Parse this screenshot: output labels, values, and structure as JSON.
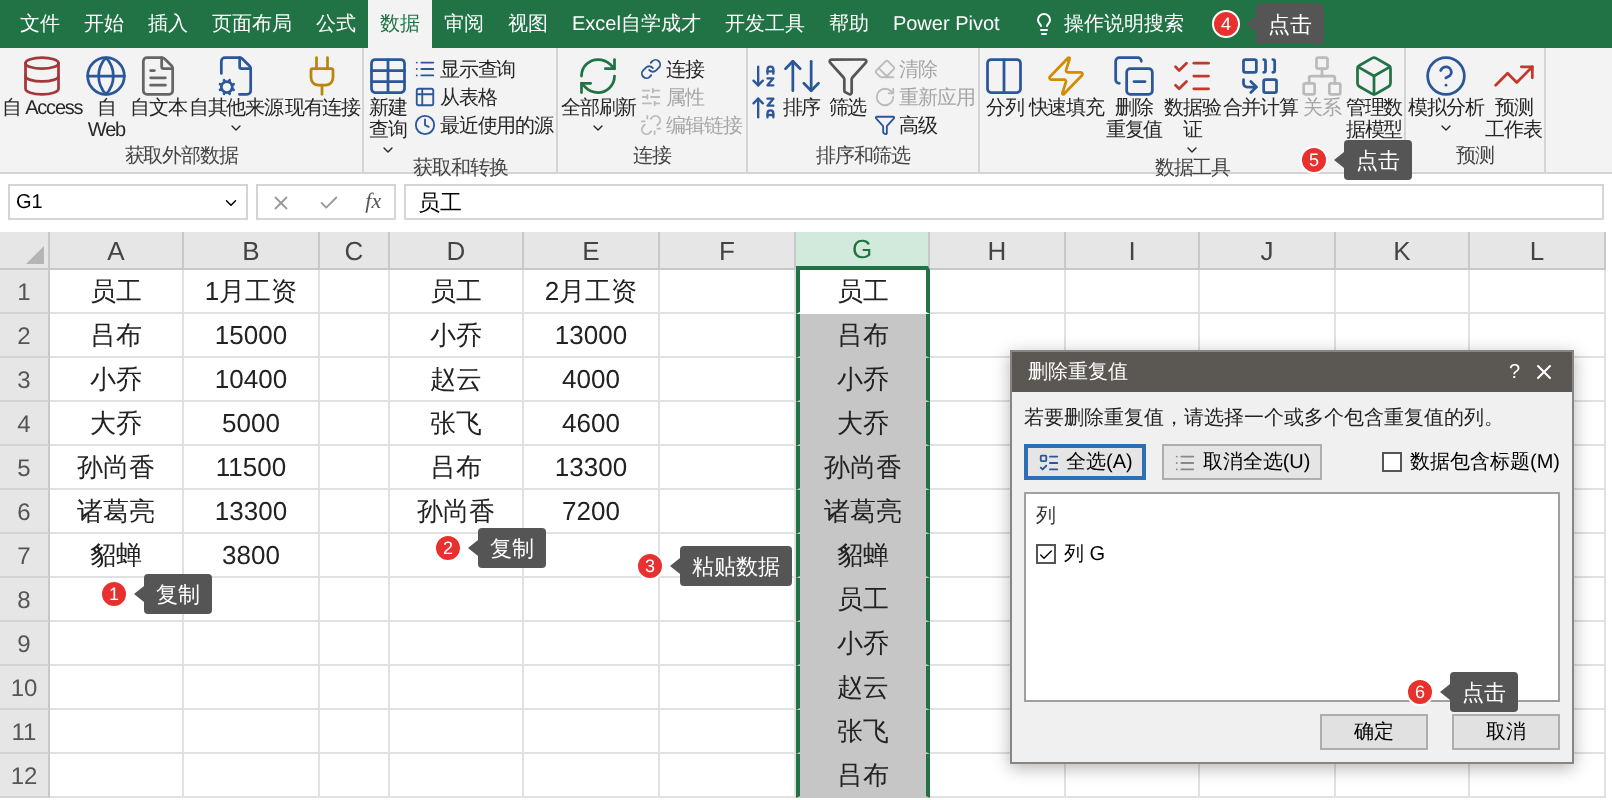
{
  "tabs": [
    {
      "label": "文件",
      "selected": false
    },
    {
      "label": "开始",
      "selected": false
    },
    {
      "label": "插入",
      "selected": false
    },
    {
      "label": "页面布局",
      "selected": false
    },
    {
      "label": "公式",
      "selected": false
    },
    {
      "label": "数据",
      "selected": true
    },
    {
      "label": "审阅",
      "selected": false
    },
    {
      "label": "视图",
      "selected": false
    },
    {
      "label": "Excel自学成才",
      "selected": false
    },
    {
      "label": "开发工具",
      "selected": false
    },
    {
      "label": "帮助",
      "selected": false
    },
    {
      "label": "Power Pivot",
      "selected": false
    }
  ],
  "search": {
    "label": "操作说明搜索"
  },
  "ribbon": {
    "groups": [
      {
        "label": "获取外部数据",
        "items": [
          {
            "kind": "large",
            "lines": [
              "自 Access"
            ],
            "dropdown": false,
            "disabled": false
          },
          {
            "kind": "large",
            "lines": [
              "自",
              "Web"
            ],
            "dropdown": false,
            "disabled": false
          },
          {
            "kind": "large",
            "lines": [
              "自文本"
            ],
            "dropdown": false,
            "disabled": false
          },
          {
            "kind": "large",
            "lines": [
              "自其他来源"
            ],
            "dropdown": true,
            "disabled": false
          },
          {
            "kind": "large",
            "lines": [
              "现有连接"
            ],
            "dropdown": false,
            "disabled": false
          }
        ]
      },
      {
        "label": "获取和转换",
        "items": [
          {
            "kind": "large",
            "lines": [
              "新建",
              "查询"
            ],
            "dropdown": true,
            "disabled": false
          },
          {
            "kind": "stack",
            "entries": [
              {
                "label": "显示查询",
                "disabled": false
              },
              {
                "label": "从表格",
                "disabled": false
              },
              {
                "label": "最近使用的源",
                "disabled": false
              }
            ]
          }
        ]
      },
      {
        "label": "连接",
        "items": [
          {
            "kind": "large",
            "lines": [
              "全部刷新"
            ],
            "dropdown": true,
            "disabled": false
          },
          {
            "kind": "stack",
            "entries": [
              {
                "label": "连接",
                "disabled": false
              },
              {
                "label": "属性",
                "disabled": true
              },
              {
                "label": "编辑链接",
                "disabled": true
              }
            ]
          }
        ]
      },
      {
        "label": "排序和筛选",
        "items": [
          {
            "kind": "sort_pair"
          },
          {
            "kind": "large",
            "lines": [
              "排序"
            ],
            "dropdown": false,
            "disabled": false
          },
          {
            "kind": "large",
            "lines": [
              "筛选"
            ],
            "dropdown": false,
            "disabled": false
          },
          {
            "kind": "stack",
            "entries": [
              {
                "label": "清除",
                "disabled": true
              },
              {
                "label": "重新应用",
                "disabled": true
              },
              {
                "label": "高级",
                "disabled": false
              }
            ]
          }
        ]
      },
      {
        "label": "数据工具",
        "items": [
          {
            "kind": "large",
            "lines": [
              "分列"
            ],
            "dropdown": false,
            "disabled": false
          },
          {
            "kind": "large",
            "lines": [
              "快速填充"
            ],
            "dropdown": false,
            "disabled": false
          },
          {
            "kind": "large",
            "lines": [
              "删除",
              "重复值"
            ],
            "dropdown": false,
            "disabled": false
          },
          {
            "kind": "large",
            "lines": [
              "数据验",
              "证"
            ],
            "dropdown": true,
            "disabled": false
          },
          {
            "kind": "large",
            "lines": [
              "合并计算"
            ],
            "dropdown": false,
            "disabled": false
          },
          {
            "kind": "large",
            "lines": [
              "关系"
            ],
            "dropdown": false,
            "disabled": true
          },
          {
            "kind": "large",
            "lines": [
              "管理数",
              "据模型"
            ],
            "dropdown": false,
            "disabled": false
          }
        ]
      },
      {
        "label": "预测",
        "items": [
          {
            "kind": "large",
            "lines": [
              "模拟分析"
            ],
            "dropdown": true,
            "disabled": false
          },
          {
            "kind": "large",
            "lines": [
              "预测",
              "工作表"
            ],
            "dropdown": false,
            "disabled": false
          }
        ]
      }
    ]
  },
  "formula_bar": {
    "name_box": "G1",
    "function_button": "fx",
    "formula": "员工"
  },
  "sheet": {
    "columns": [
      {
        "letter": "A",
        "selected": false
      },
      {
        "letter": "B",
        "selected": false
      },
      {
        "letter": "C",
        "selected": false
      },
      {
        "letter": "D",
        "selected": false
      },
      {
        "letter": "E",
        "selected": false
      },
      {
        "letter": "F",
        "selected": false
      },
      {
        "letter": "G",
        "selected": true
      },
      {
        "letter": "H",
        "selected": false
      },
      {
        "letter": "I",
        "selected": false
      },
      {
        "letter": "J",
        "selected": false
      },
      {
        "letter": "K",
        "selected": false
      },
      {
        "letter": "L",
        "selected": false
      }
    ],
    "rows": [
      {
        "number": "1",
        "cells": [
          {
            "text": "员工",
            "selected": false,
            "active": false
          },
          {
            "text": "1月工资",
            "selected": false,
            "active": false
          },
          {
            "text": "",
            "selected": false,
            "active": false
          },
          {
            "text": "员工",
            "selected": false,
            "active": false
          },
          {
            "text": "2月工资",
            "selected": false,
            "active": false
          },
          {
            "text": "",
            "selected": false,
            "active": false
          },
          {
            "text": "员工",
            "selected": true,
            "active": true
          }
        ]
      },
      {
        "number": "2",
        "cells": [
          {
            "text": "吕布",
            "selected": false,
            "active": false
          },
          {
            "text": "15000",
            "selected": false,
            "active": false
          },
          {
            "text": "",
            "selected": false,
            "active": false
          },
          {
            "text": "小乔",
            "selected": false,
            "active": false
          },
          {
            "text": "13000",
            "selected": false,
            "active": false
          },
          {
            "text": "",
            "selected": false,
            "active": false
          },
          {
            "text": "吕布",
            "selected": true,
            "active": false
          }
        ]
      },
      {
        "number": "3",
        "cells": [
          {
            "text": "小乔",
            "selected": false,
            "active": false
          },
          {
            "text": "10400",
            "selected": false,
            "active": false
          },
          {
            "text": "",
            "selected": false,
            "active": false
          },
          {
            "text": "赵云",
            "selected": false,
            "active": false
          },
          {
            "text": "4000",
            "selected": false,
            "active": false
          },
          {
            "text": "",
            "selected": false,
            "active": false
          },
          {
            "text": "小乔",
            "selected": true,
            "active": false
          }
        ]
      },
      {
        "number": "4",
        "cells": [
          {
            "text": "大乔",
            "selected": false,
            "active": false
          },
          {
            "text": "5000",
            "selected": false,
            "active": false
          },
          {
            "text": "",
            "selected": false,
            "active": false
          },
          {
            "text": "张飞",
            "selected": false,
            "active": false
          },
          {
            "text": "4600",
            "selected": false,
            "active": false
          },
          {
            "text": "",
            "selected": false,
            "active": false
          },
          {
            "text": "大乔",
            "selected": true,
            "active": false
          }
        ]
      },
      {
        "number": "5",
        "cells": [
          {
            "text": "孙尚香",
            "selected": false,
            "active": false
          },
          {
            "text": "11500",
            "selected": false,
            "active": false
          },
          {
            "text": "",
            "selected": false,
            "active": false
          },
          {
            "text": "吕布",
            "selected": false,
            "active": false
          },
          {
            "text": "13300",
            "selected": false,
            "active": false
          },
          {
            "text": "",
            "selected": false,
            "active": false
          },
          {
            "text": "孙尚香",
            "selected": true,
            "active": false
          }
        ]
      },
      {
        "number": "6",
        "cells": [
          {
            "text": "诸葛亮",
            "selected": false,
            "active": false
          },
          {
            "text": "13300",
            "selected": false,
            "active": false
          },
          {
            "text": "",
            "selected": false,
            "active": false
          },
          {
            "text": "孙尚香",
            "selected": false,
            "active": false
          },
          {
            "text": "7200",
            "selected": false,
            "active": false
          },
          {
            "text": "",
            "selected": false,
            "active": false
          },
          {
            "text": "诸葛亮",
            "selected": true,
            "active": false
          }
        ]
      },
      {
        "number": "7",
        "cells": [
          {
            "text": "貂蝉",
            "selected": false,
            "active": false
          },
          {
            "text": "3800",
            "selected": false,
            "active": false
          },
          {
            "text": "",
            "selected": false,
            "active": false
          },
          {
            "text": "",
            "selected": false,
            "active": false
          },
          {
            "text": "",
            "selected": false,
            "active": false
          },
          {
            "text": "",
            "selected": false,
            "active": false
          },
          {
            "text": "貂蝉",
            "selected": true,
            "active": false
          }
        ]
      },
      {
        "number": "8",
        "cells": [
          {
            "text": "",
            "selected": false,
            "active": false
          },
          {
            "text": "",
            "selected": false,
            "active": false
          },
          {
            "text": "",
            "selected": false,
            "active": false
          },
          {
            "text": "",
            "selected": false,
            "active": false
          },
          {
            "text": "",
            "selected": false,
            "active": false
          },
          {
            "text": "",
            "selected": false,
            "active": false
          },
          {
            "text": "员工",
            "selected": true,
            "active": false
          }
        ]
      },
      {
        "number": "9",
        "cells": [
          {
            "text": "",
            "selected": false,
            "active": false
          },
          {
            "text": "",
            "selected": false,
            "active": false
          },
          {
            "text": "",
            "selected": false,
            "active": false
          },
          {
            "text": "",
            "selected": false,
            "active": false
          },
          {
            "text": "",
            "selected": false,
            "active": false
          },
          {
            "text": "",
            "selected": false,
            "active": false
          },
          {
            "text": "小乔",
            "selected": true,
            "active": false
          }
        ]
      },
      {
        "number": "10",
        "cells": [
          {
            "text": "",
            "selected": false,
            "active": false
          },
          {
            "text": "",
            "selected": false,
            "active": false
          },
          {
            "text": "",
            "selected": false,
            "active": false
          },
          {
            "text": "",
            "selected": false,
            "active": false
          },
          {
            "text": "",
            "selected": false,
            "active": false
          },
          {
            "text": "",
            "selected": false,
            "active": false
          },
          {
            "text": "赵云",
            "selected": true,
            "active": false
          }
        ]
      },
      {
        "number": "11",
        "cells": [
          {
            "text": "",
            "selected": false,
            "active": false
          },
          {
            "text": "",
            "selected": false,
            "active": false
          },
          {
            "text": "",
            "selected": false,
            "active": false
          },
          {
            "text": "",
            "selected": false,
            "active": false
          },
          {
            "text": "",
            "selected": false,
            "active": false
          },
          {
            "text": "",
            "selected": false,
            "active": false
          },
          {
            "text": "张飞",
            "selected": true,
            "active": false
          }
        ]
      },
      {
        "number": "12",
        "cells": [
          {
            "text": "",
            "selected": false,
            "active": false
          },
          {
            "text": "",
            "selected": false,
            "active": false
          },
          {
            "text": "",
            "selected": false,
            "active": false
          },
          {
            "text": "",
            "selected": false,
            "active": false
          },
          {
            "text": "",
            "selected": false,
            "active": false
          },
          {
            "text": "",
            "selected": false,
            "active": false
          },
          {
            "text": "吕布",
            "selected": true,
            "active": false
          }
        ]
      }
    ]
  },
  "dialog": {
    "title": "删除重复值",
    "help": "?",
    "instruction": "若要删除重复值，请选择一个或多个包含重复值的列。",
    "select_all": {
      "label": "全选(A)",
      "focused": true
    },
    "unselect_all": {
      "label": "取消全选(U)",
      "focused": false
    },
    "has_headers": {
      "label": "数据包含标题(M)",
      "checked": false
    },
    "list_header": "列",
    "columns": [
      {
        "label": "列 G",
        "checked": true
      }
    ],
    "ok": "确定",
    "cancel": "取消"
  },
  "callouts": [
    {
      "number": "1",
      "text": "复制"
    },
    {
      "number": "2",
      "text": "复制"
    },
    {
      "number": "3",
      "text": "粘贴数据"
    },
    {
      "number": "4",
      "text": "点击"
    },
    {
      "number": "5",
      "text": "点击"
    },
    {
      "number": "6",
      "text": "点击"
    }
  ]
}
